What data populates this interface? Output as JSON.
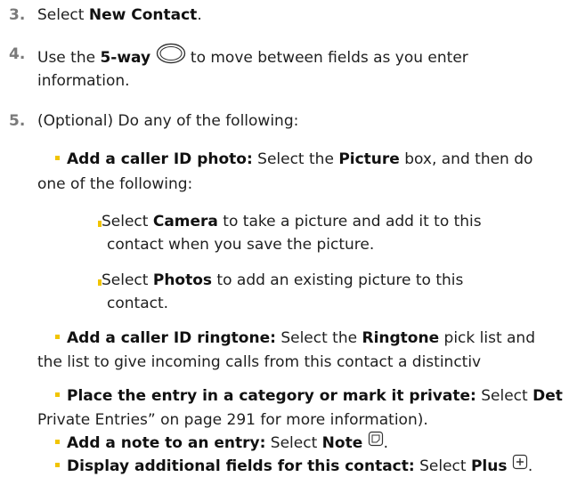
{
  "steps": {
    "s3": {
      "num": "3.",
      "pre": "Select ",
      "bold": "New Contact",
      "post": "."
    },
    "s4": {
      "num": "4.",
      "pre": "Use the ",
      "bold": "5-way",
      "post": " to move between fields as you enter",
      "line2": "information.",
      "icon": "5-way-navigation-key-icon"
    },
    "s5": {
      "num": "5.",
      "text": "(Optional) Do any of the following:"
    }
  },
  "bullets": {
    "photo": {
      "bold": "Add a caller ID photo:",
      "mid": " Select the ",
      "bold2": "Picture",
      "post": " box, and then do",
      "line2": "one of the following:"
    },
    "camera": {
      "pre": "Select ",
      "bold": "Camera",
      "post": " to take a picture and add it to this",
      "line2": "contact when you save the picture."
    },
    "photos": {
      "pre": "Select ",
      "bold": "Photos",
      "post": " to add an existing picture to this",
      "line2": "contact."
    },
    "ringtone": {
      "bold": "Add a caller ID ringtone:",
      "mid": " Select the ",
      "bold2": "Ringtone",
      "post": " pick list and",
      "line2": "the list to give incoming calls from this contact a distinctiv"
    },
    "category": {
      "bold": "Place the entry in a category or mark it private:",
      "mid": " Select ",
      "bold2": "Det",
      "line2": "Private Entries” on page 291 for more information)."
    },
    "note": {
      "bold": "Add a note to an entry:",
      "mid": " Select ",
      "bold2": "Note",
      "post": ".",
      "icon": "note-icon"
    },
    "plus": {
      "bold": "Display additional fields for this contact:",
      "mid": " Select ",
      "bold2": "Plus",
      "post": ".",
      "icon": "plus-icon"
    }
  },
  "colors": {
    "accent": "#f1c400",
    "step_number": "#7a7a7a"
  }
}
